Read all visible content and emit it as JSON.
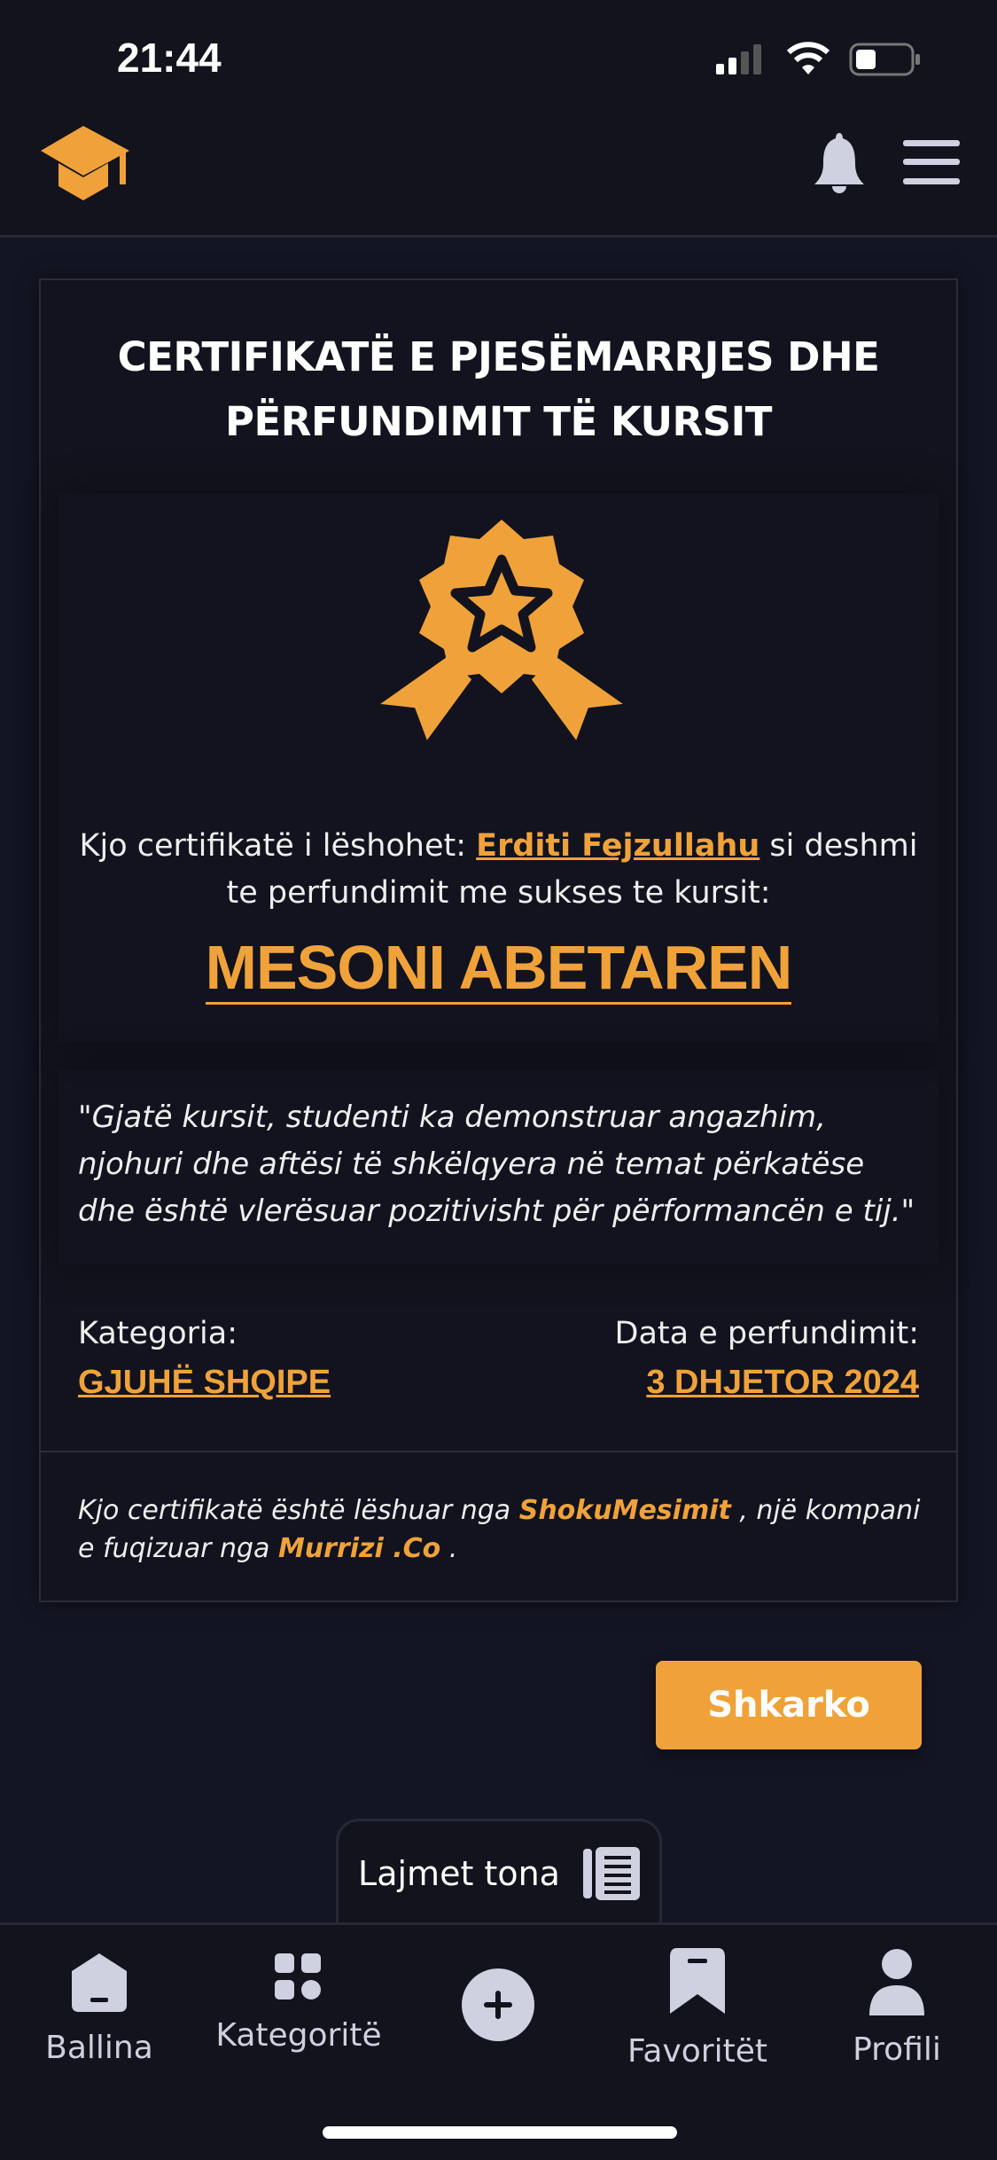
{
  "status": {
    "time": "21:44"
  },
  "header": {
    "logo_icon": "graduation-cap-icon",
    "bell_icon": "bell-icon",
    "menu_icon": "hamburger-menu-icon"
  },
  "certificate": {
    "title_line1": "CERTIFIKATË E PJESËMARRJES DHE",
    "title_line2": "PËRFUNDIMIT TË KURSIT",
    "badge_icon": "award-ribbon-icon",
    "issued_prefix": "Kjo certifikatë i lëshohet: ",
    "recipient": "Erditi Fejzullahu",
    "issued_suffix": " si deshmi",
    "issued_line2": "te perfundimit me sukses te kursit:",
    "course": "MESONI ABETAREN",
    "quote": "\"Gjatë kursit, studenti ka demonstruar angazhim, njohuri dhe aftësi të shkëlqyera në temat përkatëse dhe është vlerësuar pozitivisht për përformancën e tij.\"",
    "category_label": "Kategoria:",
    "category": "GJUHË SHQIPE",
    "date_label": "Data e perfundimit:",
    "date": "3 DHJETOR 2024",
    "footer_1": "Kjo certifikatë është lëshuar nga ",
    "footer_company": "ShokuMesimit",
    "footer_2": " , një kompani e fuqizuar nga ",
    "footer_parent": "Murrizi .Co",
    "footer_3": " ."
  },
  "download_button": "Shkarko",
  "news_tab": "Lajmet tona",
  "accent_color": "#f0a23a",
  "nav": [
    {
      "label": "Ballina",
      "icon": "home-icon"
    },
    {
      "label": "Kategoritë",
      "icon": "grid-icon"
    },
    {
      "label": "",
      "icon": "plus-icon"
    },
    {
      "label": "Favoritët",
      "icon": "bookmark-icon"
    },
    {
      "label": "Profili",
      "icon": "user-icon"
    }
  ]
}
